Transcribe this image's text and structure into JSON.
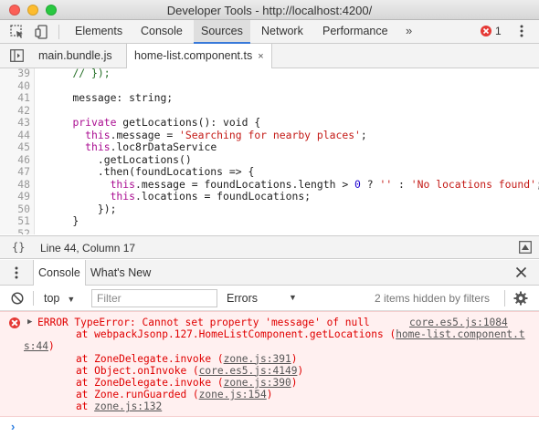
{
  "window": {
    "title": "Developer Tools - http://localhost:4200/"
  },
  "main_tabs": [
    {
      "label": "Elements"
    },
    {
      "label": "Console"
    },
    {
      "label": "Sources"
    },
    {
      "label": "Network"
    },
    {
      "label": "Performance"
    }
  ],
  "active_main_tab": "Sources",
  "overflow_label": "»",
  "error_count": "1",
  "file_tabs": [
    {
      "label": "main.bundle.js"
    },
    {
      "label": "home-list.component.ts",
      "close": "×"
    }
  ],
  "editor": {
    "lines": [
      {
        "n": "39",
        "segs": [
          {
            "t": "    "
          },
          {
            "t": "// });",
            "c": "cmt"
          }
        ]
      },
      {
        "n": "40",
        "segs": []
      },
      {
        "n": "41",
        "segs": [
          {
            "t": "    message: string;"
          }
        ]
      },
      {
        "n": "42",
        "segs": []
      },
      {
        "n": "43",
        "segs": [
          {
            "t": "    "
          },
          {
            "t": "private",
            "c": "kw"
          },
          {
            "t": " getLocations(): void {"
          }
        ]
      },
      {
        "n": "44",
        "segs": [
          {
            "t": "      "
          },
          {
            "t": "this",
            "c": "kw"
          },
          {
            "t": ".message = "
          },
          {
            "t": "'Searching for nearby places'",
            "c": "str"
          },
          {
            "t": ";"
          }
        ]
      },
      {
        "n": "45",
        "segs": [
          {
            "t": "      "
          },
          {
            "t": "this",
            "c": "kw"
          },
          {
            "t": ".loc8rDataService"
          }
        ]
      },
      {
        "n": "46",
        "segs": [
          {
            "t": "        .getLocations()"
          }
        ]
      },
      {
        "n": "47",
        "segs": [
          {
            "t": "        .then(foundLocations => {"
          }
        ]
      },
      {
        "n": "48",
        "segs": [
          {
            "t": "          "
          },
          {
            "t": "this",
            "c": "kw"
          },
          {
            "t": ".message = foundLocations.length > "
          },
          {
            "t": "0",
            "c": "num"
          },
          {
            "t": " ? "
          },
          {
            "t": "''",
            "c": "str"
          },
          {
            "t": " : "
          },
          {
            "t": "'No locations found'",
            "c": "str"
          },
          {
            "t": ";"
          }
        ]
      },
      {
        "n": "49",
        "segs": [
          {
            "t": "          "
          },
          {
            "t": "this",
            "c": "kw"
          },
          {
            "t": ".locations = foundLocations;"
          }
        ]
      },
      {
        "n": "50",
        "segs": [
          {
            "t": "        });"
          }
        ]
      },
      {
        "n": "51",
        "segs": [
          {
            "t": "    }"
          }
        ]
      },
      {
        "n": "52",
        "segs": []
      }
    ]
  },
  "status": {
    "braces": "{}",
    "text": "Line 44, Column 17"
  },
  "drawer_tabs": [
    {
      "label": "Console"
    },
    {
      "label": "What's New"
    }
  ],
  "filter": {
    "context": "top",
    "placeholder": "Filter",
    "levels": "Errors",
    "hidden": "2 items hidden by filters"
  },
  "console": {
    "error_lines": [
      {
        "text": "ERROR TypeError: Cannot set property 'message' of null",
        "link": "core.es5.js:1084"
      },
      {
        "text": "    at webpackJsonp.127.HomeListComponent.getLocations (",
        "link": "home-list.component.t"
      },
      {
        "text": "",
        "link": "s:44",
        "suffix": ")"
      },
      {
        "text": "    at ZoneDelegate.invoke (",
        "link": "zone.js:391",
        "suffix": ")"
      },
      {
        "text": "    at Object.onInvoke (",
        "link": "core.es5.js:4149",
        "suffix": ")"
      },
      {
        "text": "    at ZoneDelegate.invoke (",
        "link": "zone.js:390",
        "suffix": ")"
      },
      {
        "text": "    at Zone.runGuarded (",
        "link": "zone.js:154",
        "suffix": ")"
      },
      {
        "text": "    at ",
        "link": "zone.js:132"
      }
    ],
    "prompt": "›"
  },
  "colors": {
    "close_light": "#fc5f57",
    "minimize_light": "#fdbc2e",
    "zoom_light": "#28c840",
    "active_tab_underline": "#3879d9",
    "error_text": "#e00000",
    "error_bg": "#fff0f0"
  }
}
